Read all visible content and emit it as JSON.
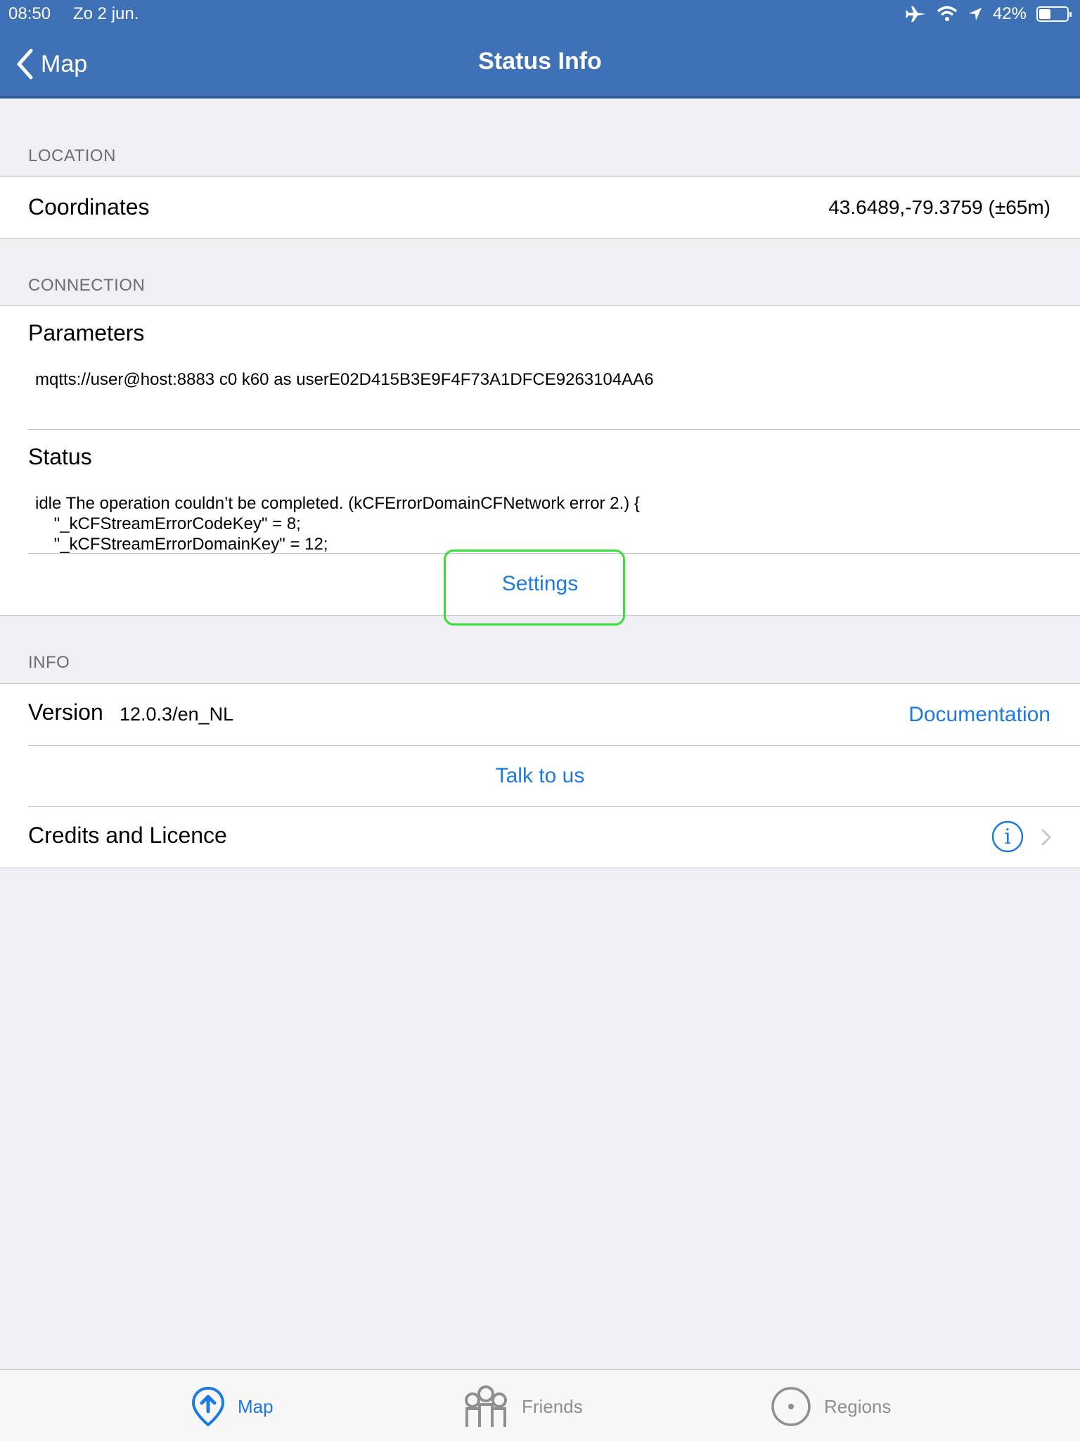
{
  "status_bar": {
    "time": "08:50",
    "date": "Zo 2 jun.",
    "battery": "42%",
    "battery_level": 0.42
  },
  "navbar": {
    "back_label": "Map",
    "title": "Status Info"
  },
  "location": {
    "header": "LOCATION",
    "coordinates_label": "Coordinates",
    "coordinates_value": "43.6489,-79.3759 (±65m)"
  },
  "connection": {
    "header": "CONNECTION",
    "parameters_label": "Parameters",
    "parameters_value": "mqtts://user@host:8883 c0 k60 as userE02D415B3E9F4F73A1DFCE9263104AA6",
    "status_label": "Status",
    "status_value": "idle The operation couldn’t be completed. (kCFErrorDomainCFNetwork error 2.) {\n    \"_kCFStreamErrorCodeKey\" = 8;\n    \"_kCFStreamErrorDomainKey\" = 12;",
    "settings_label": "Settings"
  },
  "info": {
    "header": "INFO",
    "version_label": "Version",
    "version_value": "12.0.3/en_NL",
    "documentation_label": "Documentation",
    "talk_label": "Talk to us",
    "credits_label": "Credits and Licence"
  },
  "tabs": [
    {
      "label": "Map",
      "icon": "map-pin-icon",
      "active": true
    },
    {
      "label": "Friends",
      "icon": "friends-icon",
      "active": false
    },
    {
      "label": "Regions",
      "icon": "regions-icon",
      "active": false
    }
  ],
  "colors": {
    "nav_background": "#3e71b6",
    "accent": "#1f7ae0",
    "highlight": "#33e033",
    "inactive_tab": "#8e8e93"
  }
}
